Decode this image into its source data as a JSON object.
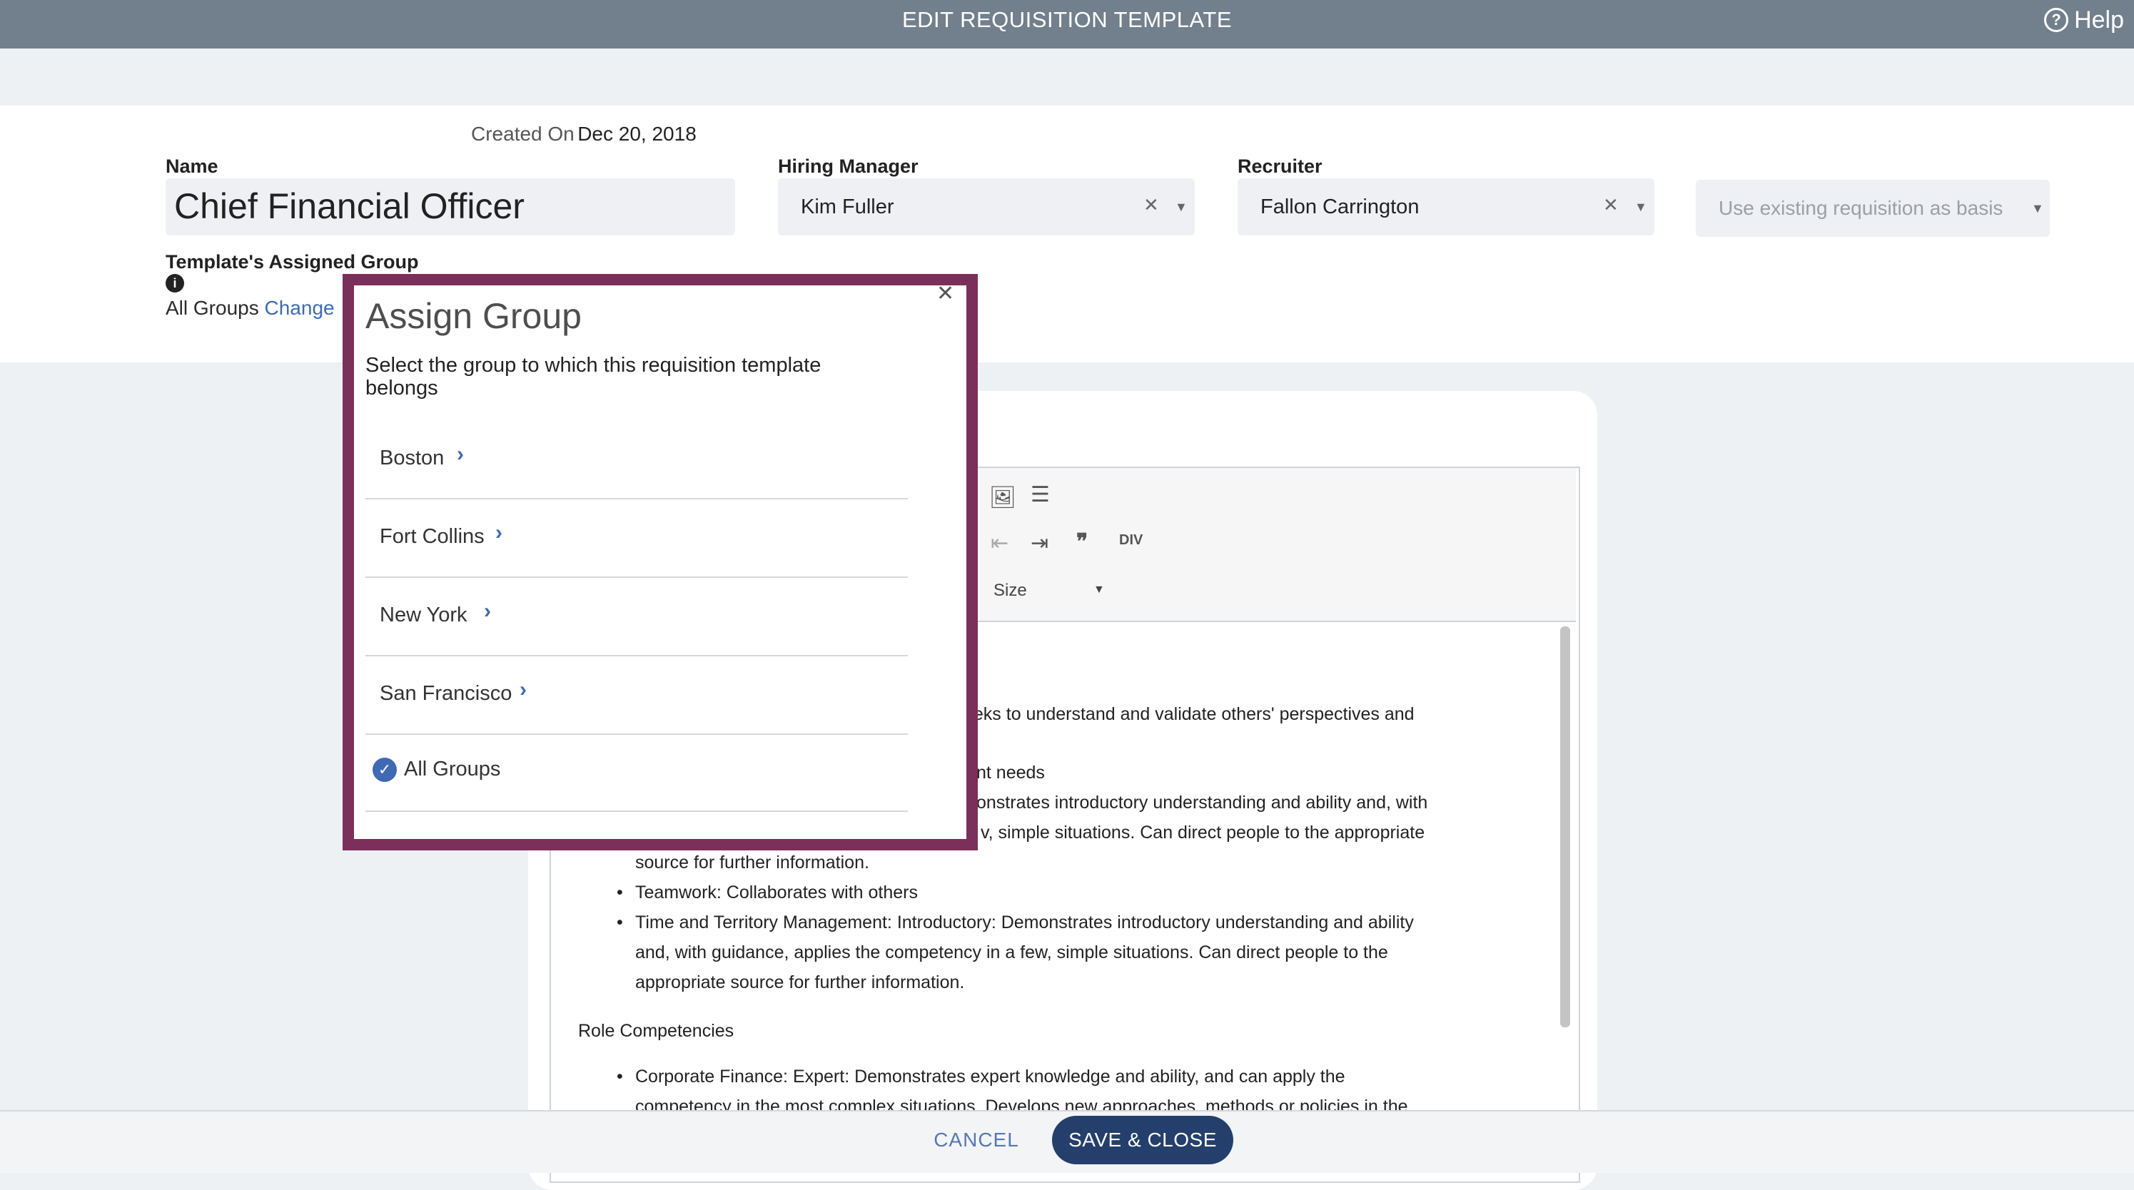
{
  "header": {
    "title": "EDIT REQUISITION TEMPLATE",
    "help_label": "Help",
    "help_icon": "question-circle-icon"
  },
  "form": {
    "created_label": "Created On",
    "created_value": "Dec 20, 2018",
    "name_label": "Name",
    "name_value": "Chief Financial Officer",
    "hiring_manager_label": "Hiring Manager",
    "hiring_manager_value": "Kim Fuller",
    "recruiter_label": "Recruiter",
    "recruiter_value": "Fallon Carrington",
    "basis_placeholder": "Use existing requisition as basis",
    "assigned_group_label": "Template's Assigned Group",
    "assigned_group_value": "All Groups",
    "change_link": "Change"
  },
  "editor": {
    "size_label": "Size",
    "lines": [
      "eeks to understand and validate others' perspectives and",
      "nt needs",
      "onstrates introductory understanding and ability and, with",
      "v, simple situations. Can direct people to the appropriate",
      "source for further information.",
      "Teamwork: Collaborates with others",
      "Time and Territory Management: Introductory: Demonstrates introductory understanding and ability",
      "and, with guidance, applies the competency in a few, simple situations. Can direct people to the",
      "appropriate source for further information.",
      "Role Competencies",
      "Corporate Finance: Expert: Demonstrates expert knowledge and ability, and can apply the",
      "competency in the most complex situations. Develops new approaches, methods or policies in the"
    ]
  },
  "modal": {
    "title": "Assign Group",
    "description": "Select the group to which this requisition template belongs",
    "groups": [
      "Boston",
      "Fort Collins",
      "New York",
      "San Francisco"
    ],
    "selected_group": "All Groups"
  },
  "footer": {
    "cancel_label": "CANCEL",
    "save_label": "SAVE & CLOSE"
  },
  "colors": {
    "topbar": "#727f8c",
    "modal_border": "#7b2f5a",
    "accent": "#3f6ab3",
    "save_button": "#243f6b"
  }
}
